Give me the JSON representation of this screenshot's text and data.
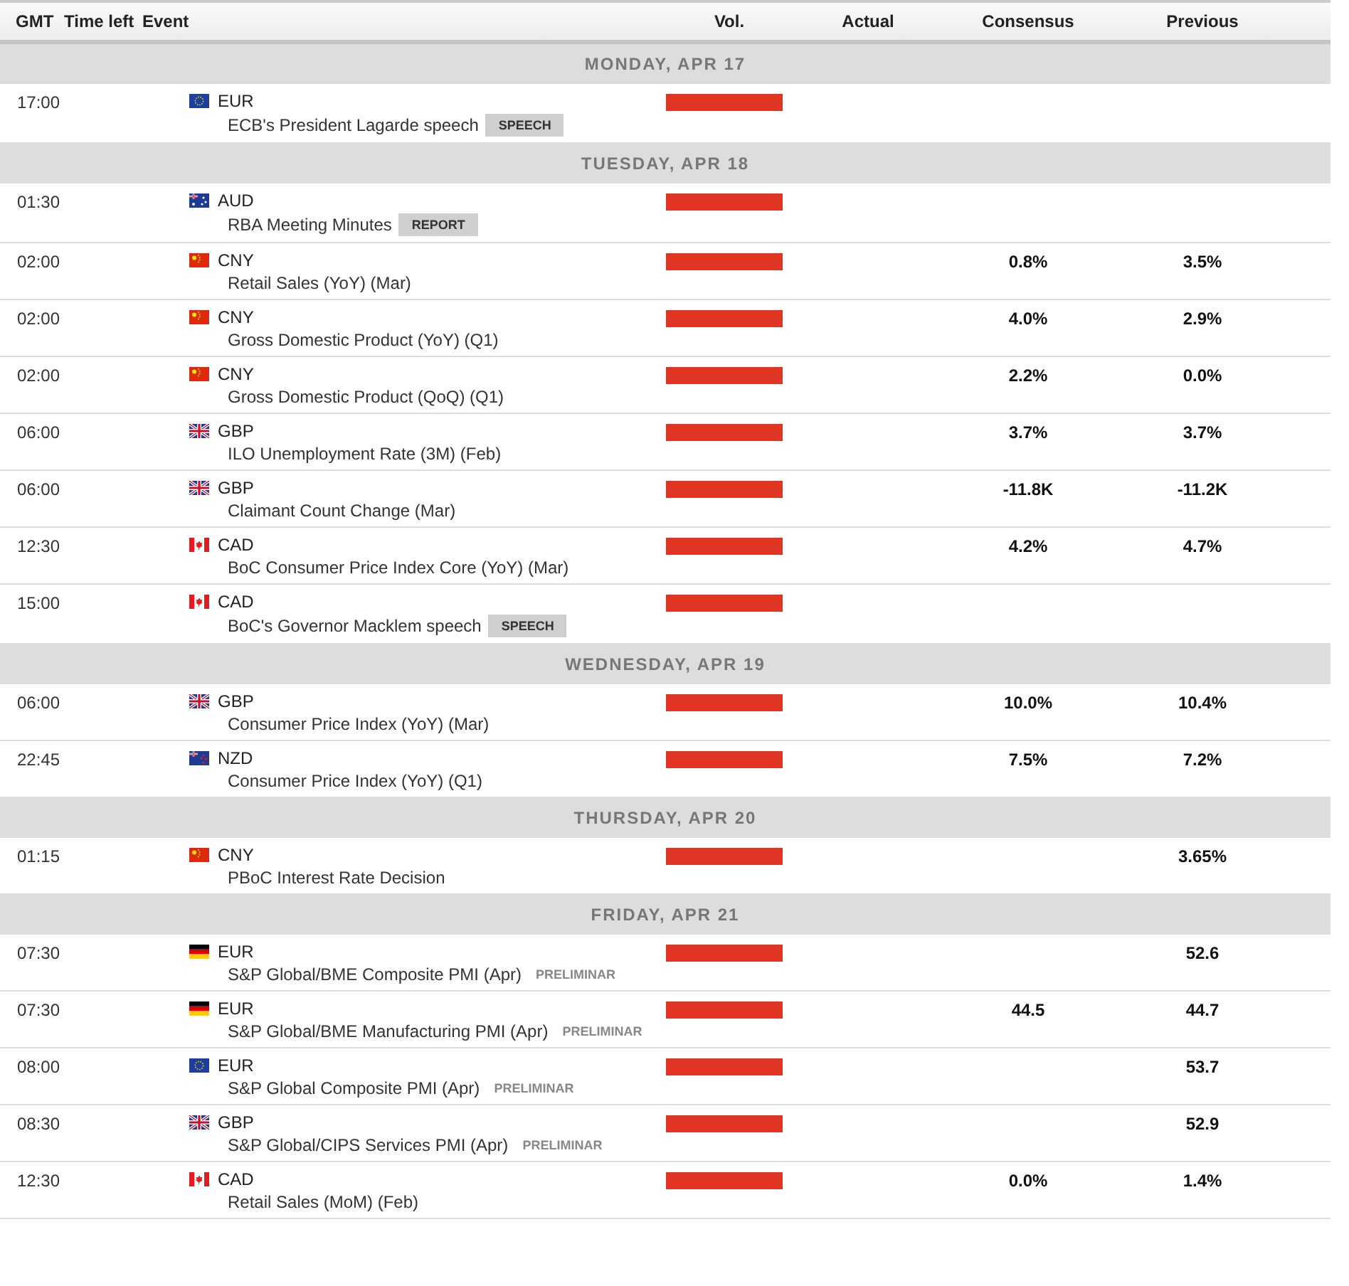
{
  "columns": [
    "GMT",
    "Time left",
    "Event",
    "Vol.",
    "Actual",
    "Consensus",
    "Previous"
  ],
  "days": [
    {
      "label": "MONDAY, APR 17",
      "events": [
        {
          "time": "17:00",
          "flag": {
            "kind": "eu"
          },
          "currency": "EUR",
          "name": "ECB's President Lagarde speech",
          "tag": {
            "text": "SPEECH",
            "kind": "boxed"
          },
          "volatility": {
            "kind": "high"
          }
        }
      ]
    },
    {
      "label": "TUESDAY, APR 18",
      "events": [
        {
          "time": "01:30",
          "flag": {
            "kind": "au"
          },
          "currency": "AUD",
          "name": "RBA Meeting Minutes",
          "tag": {
            "text": "REPORT",
            "kind": "boxed"
          },
          "volatility": {
            "kind": "high"
          }
        },
        {
          "time": "02:00",
          "flag": {
            "kind": "cn"
          },
          "currency": "CNY",
          "name": "Retail Sales (YoY) (Mar)",
          "volatility": {
            "kind": "high"
          },
          "consensus": "0.8%",
          "previous": "3.5%"
        },
        {
          "time": "02:00",
          "flag": {
            "kind": "cn"
          },
          "currency": "CNY",
          "name": "Gross Domestic Product (YoY) (Q1)",
          "volatility": {
            "kind": "high"
          },
          "consensus": "4.0%",
          "previous": "2.9%"
        },
        {
          "time": "02:00",
          "flag": {
            "kind": "cn"
          },
          "currency": "CNY",
          "name": "Gross Domestic Product (QoQ) (Q1)",
          "volatility": {
            "kind": "high"
          },
          "consensus": "2.2%",
          "previous": "0.0%"
        },
        {
          "time": "06:00",
          "flag": {
            "kind": "gb"
          },
          "currency": "GBP",
          "name": "ILO Unemployment Rate (3M) (Feb)",
          "volatility": {
            "kind": "high"
          },
          "consensus": "3.7%",
          "previous": "3.7%"
        },
        {
          "time": "06:00",
          "flag": {
            "kind": "gb"
          },
          "currency": "GBP",
          "name": "Claimant Count Change (Mar)",
          "volatility": {
            "kind": "high"
          },
          "consensus": "-11.8K",
          "previous": "-11.2K"
        },
        {
          "time": "12:30",
          "flag": {
            "kind": "ca"
          },
          "currency": "CAD",
          "name": "BoC Consumer Price Index Core (YoY) (Mar)",
          "volatility": {
            "kind": "high"
          },
          "consensus": "4.2%",
          "previous": "4.7%"
        },
        {
          "time": "15:00",
          "flag": {
            "kind": "ca"
          },
          "currency": "CAD",
          "name": "BoC's Governor Macklem speech",
          "tag": {
            "text": "SPEECH",
            "kind": "boxed"
          },
          "volatility": {
            "kind": "high"
          }
        }
      ]
    },
    {
      "label": "WEDNESDAY, APR 19",
      "events": [
        {
          "time": "06:00",
          "flag": {
            "kind": "gb"
          },
          "currency": "GBP",
          "name": "Consumer Price Index (YoY) (Mar)",
          "volatility": {
            "kind": "high"
          },
          "consensus": "10.0%",
          "previous": "10.4%"
        },
        {
          "time": "22:45",
          "flag": {
            "kind": "nz"
          },
          "currency": "NZD",
          "name": "Consumer Price Index (YoY) (Q1)",
          "volatility": {
            "kind": "high"
          },
          "consensus": "7.5%",
          "previous": "7.2%"
        }
      ]
    },
    {
      "label": "THURSDAY, APR 20",
      "events": [
        {
          "time": "01:15",
          "flag": {
            "kind": "cn"
          },
          "currency": "CNY",
          "name": "PBoC Interest Rate Decision",
          "volatility": {
            "kind": "high"
          },
          "previous": "3.65%"
        }
      ]
    },
    {
      "label": "FRIDAY, APR 21",
      "events": [
        {
          "time": "07:30",
          "flag": {
            "kind": "de"
          },
          "currency": "EUR",
          "name": "S&P Global/BME Composite PMI (Apr)",
          "tag": {
            "text": "PRELIMINAR",
            "kind": "plain"
          },
          "volatility": {
            "kind": "high"
          },
          "previous": "52.6"
        },
        {
          "time": "07:30",
          "flag": {
            "kind": "de"
          },
          "currency": "EUR",
          "name": "S&P Global/BME Manufacturing PMI (Apr)",
          "tag": {
            "text": "PRELIMINAR",
            "kind": "plain"
          },
          "volatility": {
            "kind": "high"
          },
          "consensus": "44.5",
          "previous": "44.7"
        },
        {
          "time": "08:00",
          "flag": {
            "kind": "eu"
          },
          "currency": "EUR",
          "name": "S&P Global Composite PMI (Apr)",
          "tag": {
            "text": "PRELIMINAR",
            "kind": "plain"
          },
          "volatility": {
            "kind": "high"
          },
          "previous": "53.7"
        },
        {
          "time": "08:30",
          "flag": {
            "kind": "gb"
          },
          "currency": "GBP",
          "name": "S&P Global/CIPS Services PMI (Apr)",
          "tag": {
            "text": "PRELIMINAR",
            "kind": "plain"
          },
          "volatility": {
            "kind": "high"
          },
          "previous": "52.9"
        },
        {
          "time": "12:30",
          "flag": {
            "kind": "ca"
          },
          "currency": "CAD",
          "name": "Retail Sales (MoM) (Feb)",
          "volatility": {
            "kind": "high"
          },
          "consensus": "0.0%",
          "previous": "1.4%"
        }
      ]
    }
  ]
}
